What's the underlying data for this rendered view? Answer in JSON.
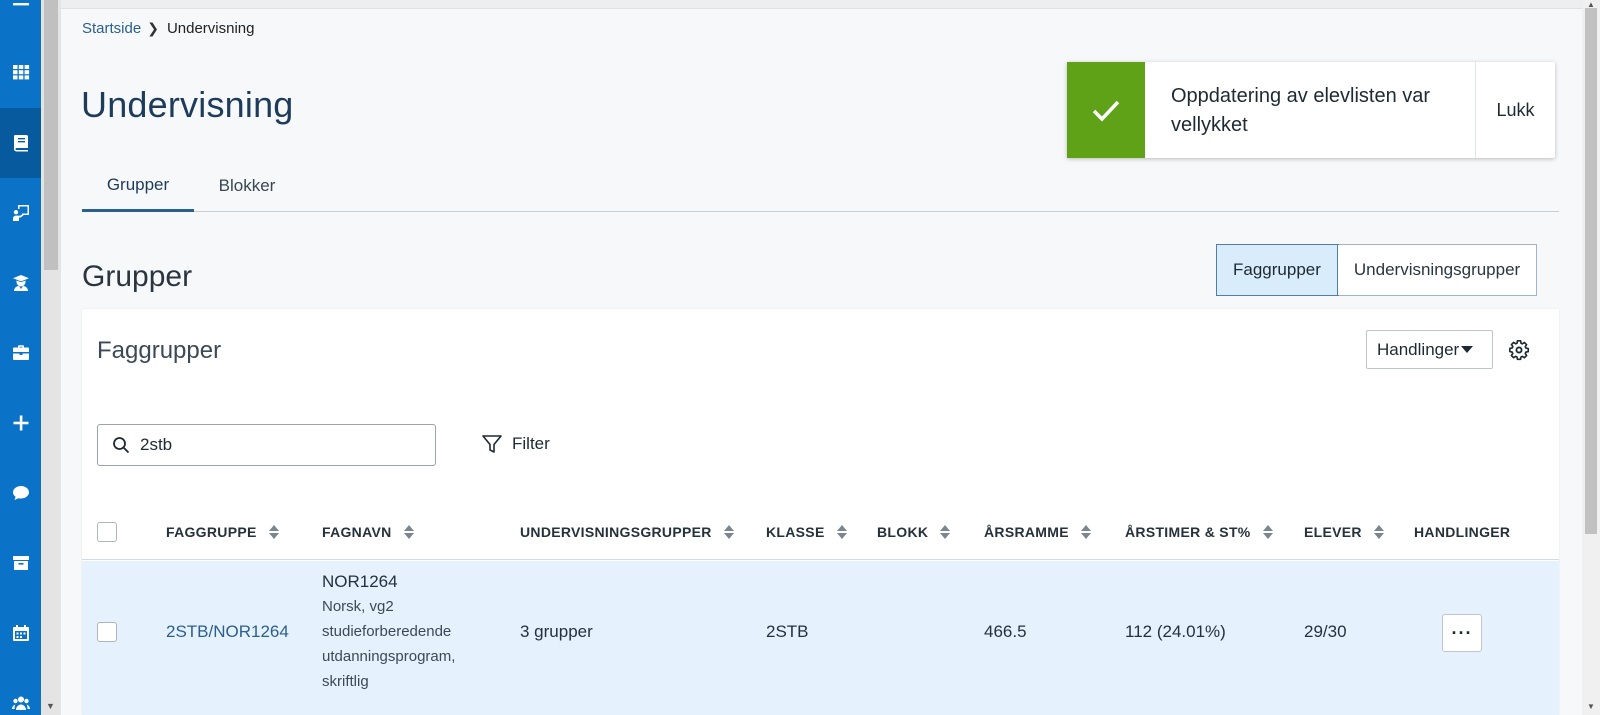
{
  "breadcrumb": {
    "home": "Startside",
    "current": "Undervisning"
  },
  "page": {
    "title": "Undervisning"
  },
  "tabs": [
    {
      "label": "Grupper",
      "active": true
    },
    {
      "label": "Blokker",
      "active": false
    }
  ],
  "toast": {
    "message": "Oppdatering av elevlisten var vellykket",
    "close_label": "Lukk",
    "accent": "#5fa218"
  },
  "section": {
    "title": "Grupper"
  },
  "view_toggle": {
    "options": [
      "Faggrupper",
      "Undervisningsgrupper"
    ],
    "selected": "Faggrupper"
  },
  "card": {
    "title": "Faggrupper",
    "actions_label": "Handlinger",
    "search_value": "2stb",
    "filter_label": "Filter"
  },
  "table": {
    "headers": {
      "faggruppe": "FAGGRUPPE",
      "fagnavn": "FAGNAVN",
      "undervisningsgrupper": "UNDERVISNINGSGRUPPER",
      "klasse": "KLASSE",
      "blokk": "BLOKK",
      "arsramme": "ÅRSRAMME",
      "arstimer": "ÅRSTIMER & ST%",
      "elever": "ELEVER",
      "handlinger": "HANDLINGER"
    },
    "rows": [
      {
        "faggruppe": "2STB/NOR1264",
        "fag_code": "NOR1264",
        "fag_desc": "Norsk, vg2 studieforberedende utdanningsprogram, skriftlig",
        "undervisningsgrupper": "3 grupper",
        "klasse": "2STB",
        "blokk": "",
        "arsramme": "466.5",
        "arstimer": "112 (24.01%)",
        "elever": "29/30",
        "more": "···"
      }
    ]
  },
  "colors": {
    "nav": "#0a73c7",
    "nav_active": "#075a9e",
    "link": "#2b5f8e",
    "row_selected": "#e5f1fc"
  }
}
